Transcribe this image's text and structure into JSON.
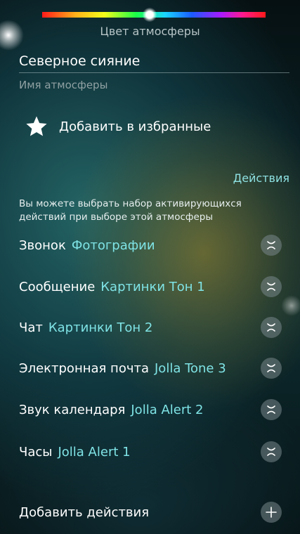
{
  "color_picker": {
    "label": "Цвет атмосферы",
    "handle_position": 0.48
  },
  "name_field": {
    "value": "Северное сияние",
    "label": "Имя атмосферы"
  },
  "favorite": {
    "icon": "star-icon",
    "label": "Добавить в избранные"
  },
  "actions": {
    "header": "Действия",
    "description": "Вы можете выбрать набор активирующихся действий при выборе этой атмосферы",
    "items": [
      {
        "label": "Звонок",
        "value": "Фотографии"
      },
      {
        "label": "Сообщение",
        "value": "Картинки Тон 1"
      },
      {
        "label": "Чат",
        "value": "Картинки Тон 2"
      },
      {
        "label": "Электронная почта",
        "value": "Jolla Tone 3"
      },
      {
        "label": "Звук календаря",
        "value": "Jolla Alert 2"
      },
      {
        "label": "Часы",
        "value": "Jolla Alert 1"
      }
    ],
    "add_label": "Добавить действия",
    "clear_icon": "close-icon",
    "add_icon": "plus-icon"
  },
  "colors": {
    "accent": "#7fe3e5",
    "secondary_text": "#8fa0a2"
  }
}
